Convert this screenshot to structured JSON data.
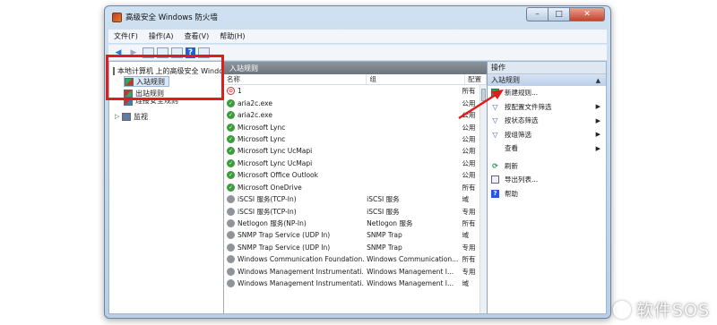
{
  "window": {
    "title": "高级安全 Windows 防火墙"
  },
  "caption": {
    "min": "–",
    "max": "□",
    "close": "✕"
  },
  "menu": [
    "文件(F)",
    "操作(A)",
    "查看(V)",
    "帮助(H)"
  ],
  "toolbar": {
    "back": "◀",
    "forward": "▶",
    "help": "?"
  },
  "tree": {
    "root": "本地计算机 上的高级安全 Windows 防火墙",
    "inbound": "入站规则",
    "outbound": "出站规则",
    "security": "连接安全规则",
    "monitor": "监视"
  },
  "list": {
    "title": "入站规则",
    "columns": {
      "name": "名称",
      "group": "组",
      "profile": "配置文件"
    },
    "rows": [
      {
        "status": "block",
        "name": "1",
        "group": "",
        "profile": "所有"
      },
      {
        "status": "allow",
        "name": "aria2c.exe",
        "group": "",
        "profile": "公用"
      },
      {
        "status": "allow",
        "name": "aria2c.exe",
        "group": "",
        "profile": "公用"
      },
      {
        "status": "allow",
        "name": "Microsoft Lync",
        "group": "",
        "profile": "公用"
      },
      {
        "status": "allow",
        "name": "Microsoft Lync",
        "group": "",
        "profile": "公用"
      },
      {
        "status": "allow",
        "name": "Microsoft Lync UcMapi",
        "group": "",
        "profile": "公用"
      },
      {
        "status": "allow",
        "name": "Microsoft Lync UcMapi",
        "group": "",
        "profile": "公用"
      },
      {
        "status": "allow",
        "name": "Microsoft Office Outlook",
        "group": "",
        "profile": "公用"
      },
      {
        "status": "allow",
        "name": "Microsoft OneDrive",
        "group": "",
        "profile": "所有"
      },
      {
        "status": "neutral",
        "name": "iSCSI 服务(TCP-In)",
        "group": "iSCSI 服务",
        "profile": "域"
      },
      {
        "status": "neutral",
        "name": "iSCSI 服务(TCP-In)",
        "group": "iSCSI 服务",
        "profile": "专用"
      },
      {
        "status": "neutral",
        "name": "Netlogon 服务(NP-In)",
        "group": "Netlogon 服务",
        "profile": "所有"
      },
      {
        "status": "neutral",
        "name": "SNMP Trap Service (UDP In)",
        "group": "SNMP Trap",
        "profile": "域"
      },
      {
        "status": "neutral",
        "name": "SNMP Trap Service (UDP In)",
        "group": "SNMP Trap",
        "profile": "专用"
      },
      {
        "status": "neutral",
        "name": "Windows Communication Foundation...",
        "group": "Windows Communication...",
        "profile": "所有"
      },
      {
        "status": "neutral",
        "name": "Windows Management Instrumentati...",
        "group": "Windows Management I...",
        "profile": "专用"
      },
      {
        "status": "neutral",
        "name": "Windows Management Instrumentati...",
        "group": "Windows Management I...",
        "profile": "域"
      }
    ]
  },
  "actions": {
    "title": "操作",
    "section": "入站规则",
    "collapse": "▲",
    "items": [
      {
        "icon": "new-rule-icon",
        "label": "新建规则...",
        "submenu": false
      },
      {
        "icon": "filter-icon",
        "label": "按配置文件筛选",
        "submenu": true
      },
      {
        "icon": "filter-icon",
        "label": "按状态筛选",
        "submenu": true
      },
      {
        "icon": "filter-icon",
        "label": "按组筛选",
        "submenu": true
      },
      {
        "icon": "none",
        "label": "查看",
        "submenu": true
      },
      {
        "icon": "refresh-icon",
        "label": "刷新",
        "submenu": false
      },
      {
        "icon": "export-icon",
        "label": "导出列表...",
        "submenu": false
      },
      {
        "icon": "help-icon",
        "label": "帮助",
        "submenu": false
      }
    ]
  },
  "watermark": {
    "text": "软件SOS"
  },
  "colors": {
    "annotation_red": "#e21b1b",
    "allow_green": "#3a9d3a",
    "block_red": "#d32f2f",
    "section_blue": "#bcd0ea"
  }
}
